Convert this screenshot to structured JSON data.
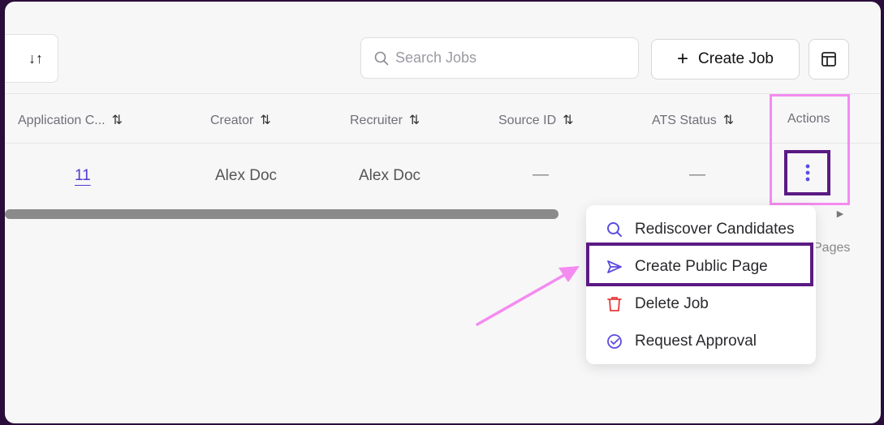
{
  "toolbar": {
    "sort_icon": "sort-arrows-icon",
    "search_placeholder": "Search Jobs",
    "create_job_label": "Create Job",
    "columns_icon": "table-columns-icon"
  },
  "table": {
    "headers": [
      "Application C...",
      "Creator",
      "Recruiter",
      "Source ID",
      "ATS Status",
      "Actions"
    ],
    "row": {
      "application_count": "11",
      "creator": "Alex Doc",
      "recruiter": "Alex Doc",
      "source_id": "—",
      "ats_status": "—"
    }
  },
  "pagination_fragment": "Pages",
  "menu": {
    "items": [
      {
        "label": "Rediscover Candidates",
        "icon": "search-icon"
      },
      {
        "label": "Create Public Page",
        "icon": "send-icon"
      },
      {
        "label": "Delete Job",
        "icon": "trash-icon"
      },
      {
        "label": "Request Approval",
        "icon": "check-circle-icon"
      }
    ]
  },
  "colors": {
    "accent": "#5b4ce0",
    "danger": "#e53b3b",
    "highlight_pink": "#f48bf0",
    "highlight_purple": "#5a1a82",
    "frame": "#2a0d3a"
  }
}
